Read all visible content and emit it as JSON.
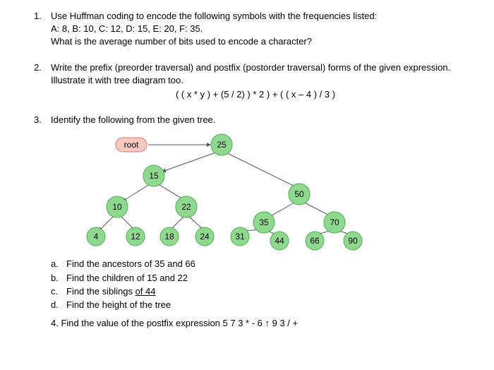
{
  "q1": {
    "num": "1.",
    "line1": "Use Huffman coding to encode the following symbols with the frequencies listed:",
    "line2": "A: 8,  B: 10,  C: 12,  D: 15,  E: 20,  F: 35.",
    "line3": "What is the average number of bits used to encode a character?"
  },
  "q2": {
    "num": "2.",
    "line1": "Write the prefix (preorder traversal) and postfix (postorder traversal) forms of the given expression.",
    "line2": "Illustrate it with tree diagram too.",
    "expr": "( ( x * y ) + (5 / 2) ) * 2 ) + ( ( x – 4 ) / 3 )"
  },
  "q3": {
    "num": "3.",
    "line1": "Identify the following from the given tree.",
    "tree": {
      "root_label": "root",
      "nodes": {
        "n25": "25",
        "n15": "15",
        "n50": "50",
        "n10": "10",
        "n22": "22",
        "n35": "35",
        "n70": "70",
        "n4": "4",
        "n12": "12",
        "n18": "18",
        "n24": "24",
        "n31": "31",
        "n44": "44",
        "n66": "66",
        "n90": "90"
      }
    },
    "sub": {
      "a_letter": "a.",
      "a_text": "Find the ancestors of 35 and 66",
      "b_letter": "b.",
      "b_text": "Find the children of 15 and 22",
      "c_letter": "c.",
      "c_text_pre": "Find the siblings ",
      "c_text_under": "of  44",
      "d_letter": "d.",
      "d_text": "Find the height of the tree"
    }
  },
  "q4": {
    "text": "4. Find the value of the postfix expression 5 7 3 * - 6 ↑ 9 3 / +"
  },
  "colors": {
    "node_fill": "#8fd98f",
    "node_stroke": "#4caf50",
    "root_fill": "#f8c9c0",
    "root_stroke": "#d08070",
    "edge": "#555"
  }
}
